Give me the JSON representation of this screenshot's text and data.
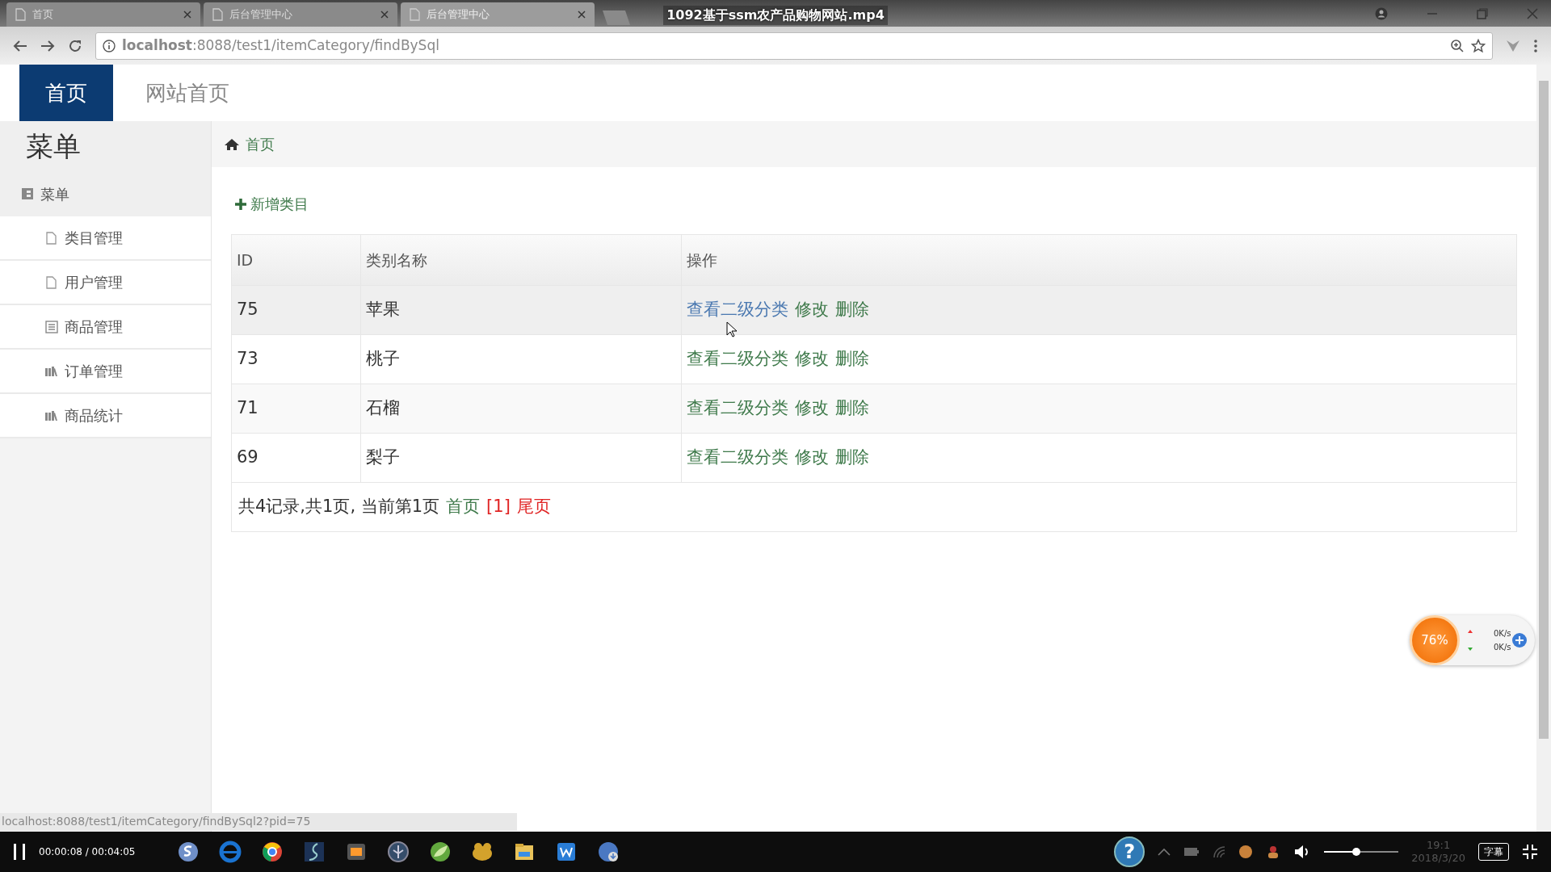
{
  "video": {
    "title": "1092基于ssm农产品购物网站.mp4",
    "time": "00:00:08 / 00:04:05",
    "volume": {
      "level": 0.43
    },
    "subtitle_button": "字幕"
  },
  "browser": {
    "tabs": [
      {
        "label": "首页",
        "selected": false
      },
      {
        "label": "后台管理中心",
        "selected": false
      },
      {
        "label": "后台管理中心",
        "selected": true
      }
    ],
    "address": "**localhost**:8088/test1/itemCategory/findBySql",
    "status_url": "localhost:8088/test1/itemCategory/findBySql2?pid=75"
  },
  "page": {
    "top_tabs": [
      {
        "label": "首页",
        "selected": true
      },
      {
        "label": "网站首页",
        "selected": false
      }
    ],
    "sidebar": {
      "title": "菜单",
      "section": "菜单",
      "items": [
        {
          "label": "类目管理",
          "kind": "file"
        },
        {
          "label": "用户管理",
          "kind": "file"
        },
        {
          "label": "商品管理",
          "kind": "list"
        },
        {
          "label": "订单管理",
          "kind": "chart"
        },
        {
          "label": "商品统计",
          "kind": "chart"
        }
      ]
    },
    "breadcrumb": "首页",
    "add_link": "新增类目",
    "table": {
      "columns": [
        "ID",
        "类别名称",
        "操作"
      ],
      "rows": [
        {
          "id": "75",
          "name": "苹果",
          "actions": [
            "查看二级分类",
            "修改",
            "删除"
          ],
          "hovered": true
        },
        {
          "id": "73",
          "name": "桃子",
          "actions": [
            "查看二级分类",
            "修改",
            "删除"
          ],
          "hovered": false
        },
        {
          "id": "71",
          "name": "石榴",
          "actions": [
            "查看二级分类",
            "修改",
            "删除"
          ],
          "hovered": false
        },
        {
          "id": "69",
          "name": "梨子",
          "actions": [
            "查看二级分类",
            "修改",
            "删除"
          ],
          "hovered": false
        }
      ]
    },
    "pagination": {
      "summary": "共4记录,共1页, 当前第1页",
      "first": "首页",
      "current": "[1]",
      "last": "尾页"
    }
  },
  "speed_widget": {
    "percent": "76%",
    "upload": "0K/s",
    "download": "0K/s"
  },
  "taskbar": {
    "help": "?",
    "time": "19:1",
    "date": "2018/3/20"
  }
}
